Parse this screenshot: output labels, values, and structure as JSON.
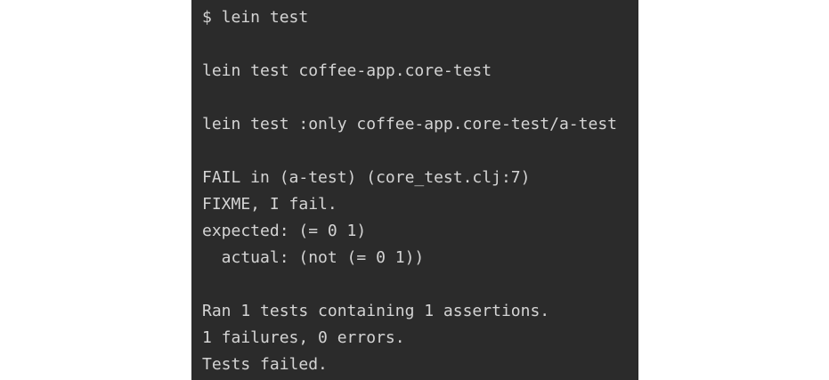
{
  "terminal": {
    "lines": [
      "$ lein test",
      "",
      "lein test coffee-app.core-test",
      "",
      "lein test :only coffee-app.core-test/a-test",
      "",
      "FAIL in (a-test) (core_test.clj:7)",
      "FIXME, I fail.",
      "expected: (= 0 1)",
      "  actual: (not (= 0 1))",
      "",
      "Ran 1 tests containing 1 assertions.",
      "1 failures, 0 errors.",
      "Tests failed."
    ]
  },
  "colors": {
    "terminal_background": "#2b2b2b",
    "terminal_text": "#d4d4d4",
    "page_background": "#ffffff"
  }
}
